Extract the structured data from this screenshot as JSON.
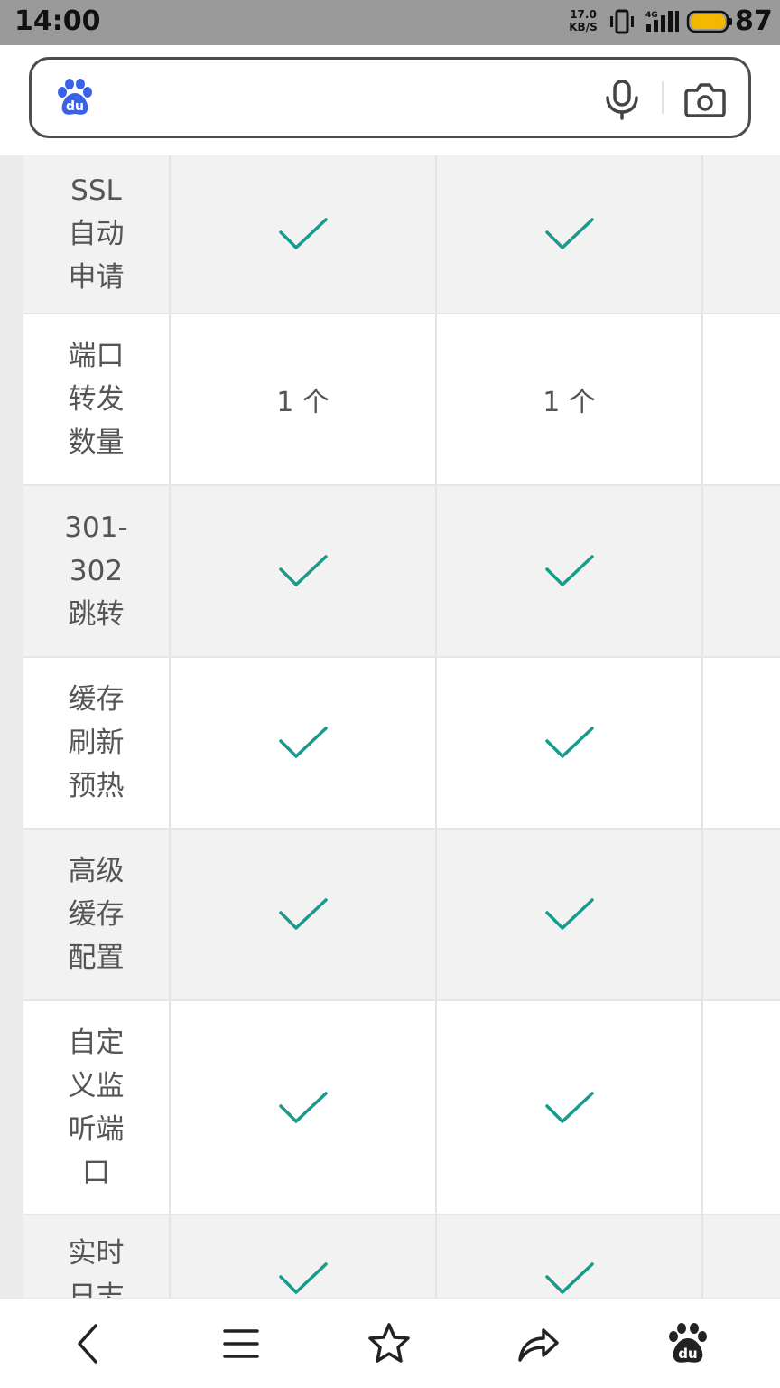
{
  "status_bar": {
    "time": "14:00",
    "net_speed_value": "17.0",
    "net_speed_unit": "KB/S",
    "network_type": "4G",
    "battery_level": "87",
    "battery_color": "#f5b800"
  },
  "search": {
    "logo_text": "du"
  },
  "table": {
    "rows": [
      {
        "label": "SSL自动申请",
        "a": "check",
        "b": "check"
      },
      {
        "label": "端口转发数量",
        "a": "1 个",
        "b": "1 个"
      },
      {
        "label": "301-302跳转",
        "a": "check",
        "b": "check"
      },
      {
        "label": "缓存刷新预热",
        "a": "check",
        "b": "check"
      },
      {
        "label": "高级缓存配置",
        "a": "check",
        "b": "check"
      },
      {
        "label": "自定义监听端口",
        "a": "check",
        "b": "check"
      },
      {
        "label": "实时日志",
        "a": "check",
        "b": "check"
      }
    ],
    "check_color": "#1a9a8a"
  },
  "bottom_nav": {
    "items": [
      "back-icon",
      "menu-icon",
      "star-icon",
      "share-icon",
      "baidu-home-icon"
    ]
  }
}
